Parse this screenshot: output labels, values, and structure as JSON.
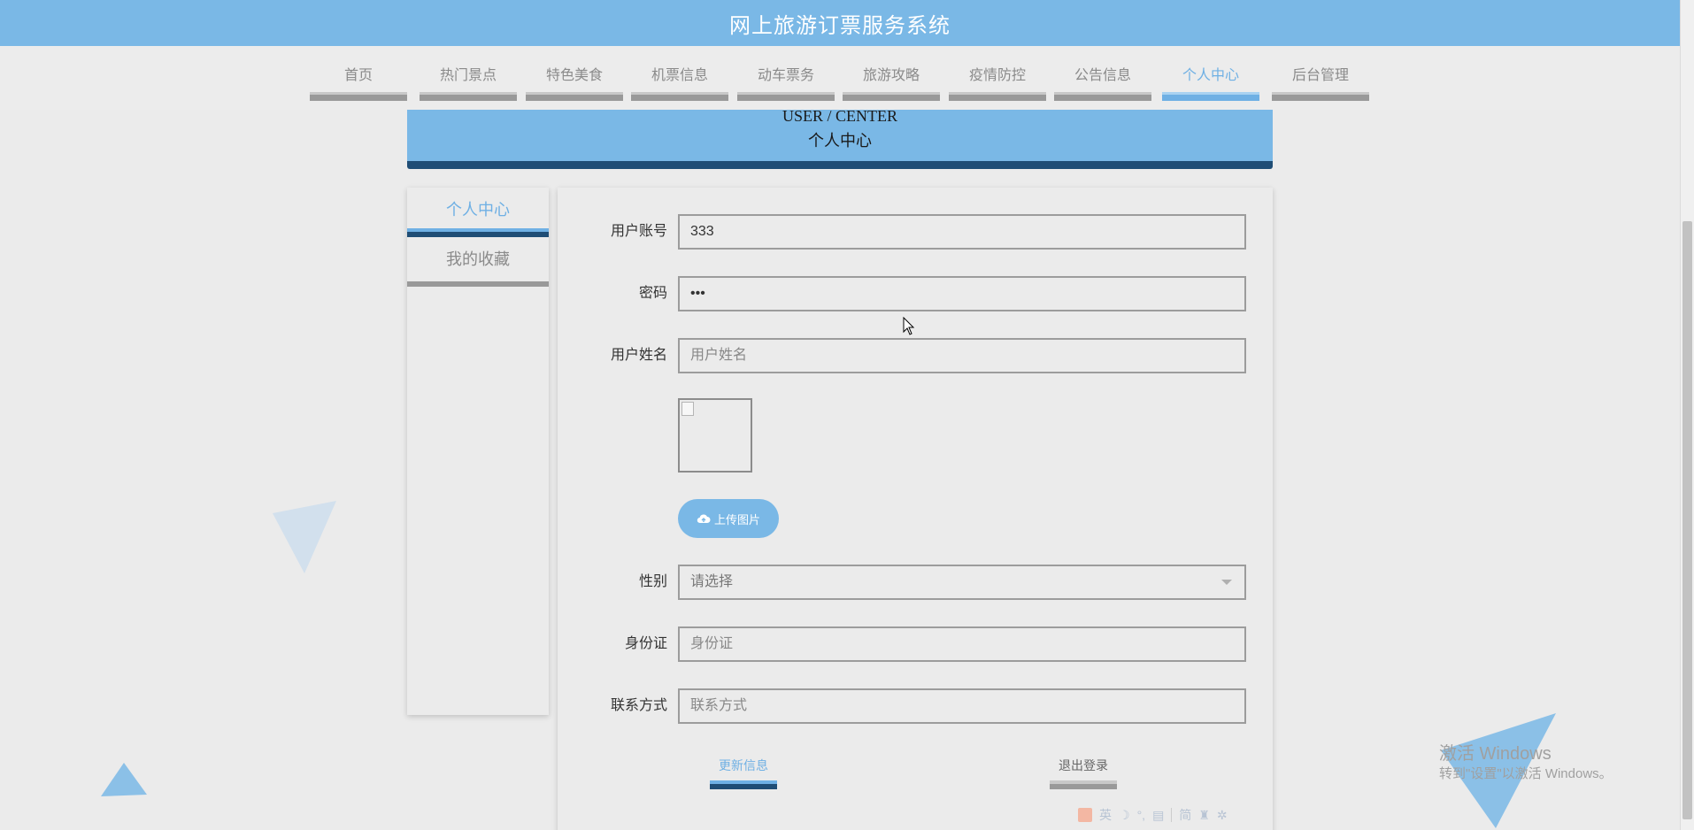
{
  "app": {
    "title": "网上旅游订票服务系统"
  },
  "nav": {
    "items": [
      {
        "label": "首页"
      },
      {
        "label": "热门景点"
      },
      {
        "label": "特色美食"
      },
      {
        "label": "机票信息"
      },
      {
        "label": "动车票务"
      },
      {
        "label": "旅游攻略"
      },
      {
        "label": "疫情防控"
      },
      {
        "label": "公告信息"
      },
      {
        "label": "个人中心",
        "active": true
      },
      {
        "label": "后台管理"
      }
    ]
  },
  "banner": {
    "english": "USER / CENTER",
    "chinese": "个人中心"
  },
  "sidebar": {
    "items": [
      {
        "label": "个人中心",
        "active": true
      },
      {
        "label": "我的收藏"
      }
    ]
  },
  "form": {
    "account": {
      "label": "用户账号",
      "value": "333"
    },
    "password": {
      "label": "密码",
      "value": "•••"
    },
    "name": {
      "label": "用户姓名",
      "placeholder": "用户姓名",
      "value": ""
    },
    "upload_label": "上传图片",
    "gender": {
      "label": "性别",
      "placeholder": "请选择"
    },
    "id_card": {
      "label": "身份证",
      "placeholder": "身份证",
      "value": ""
    },
    "contact": {
      "label": "联系方式",
      "placeholder": "联系方式",
      "value": ""
    },
    "update_label": "更新信息",
    "logout_label": "退出登录"
  },
  "watermark": {
    "line1": "激活 Windows",
    "line2": "转到\"设置\"以激活 Windows。"
  },
  "ime": {
    "lang": "英",
    "mode": "简"
  },
  "colors": {
    "accent": "#7ab8e6",
    "dark_accent": "#1f4d75",
    "background": "#ebebeb"
  }
}
